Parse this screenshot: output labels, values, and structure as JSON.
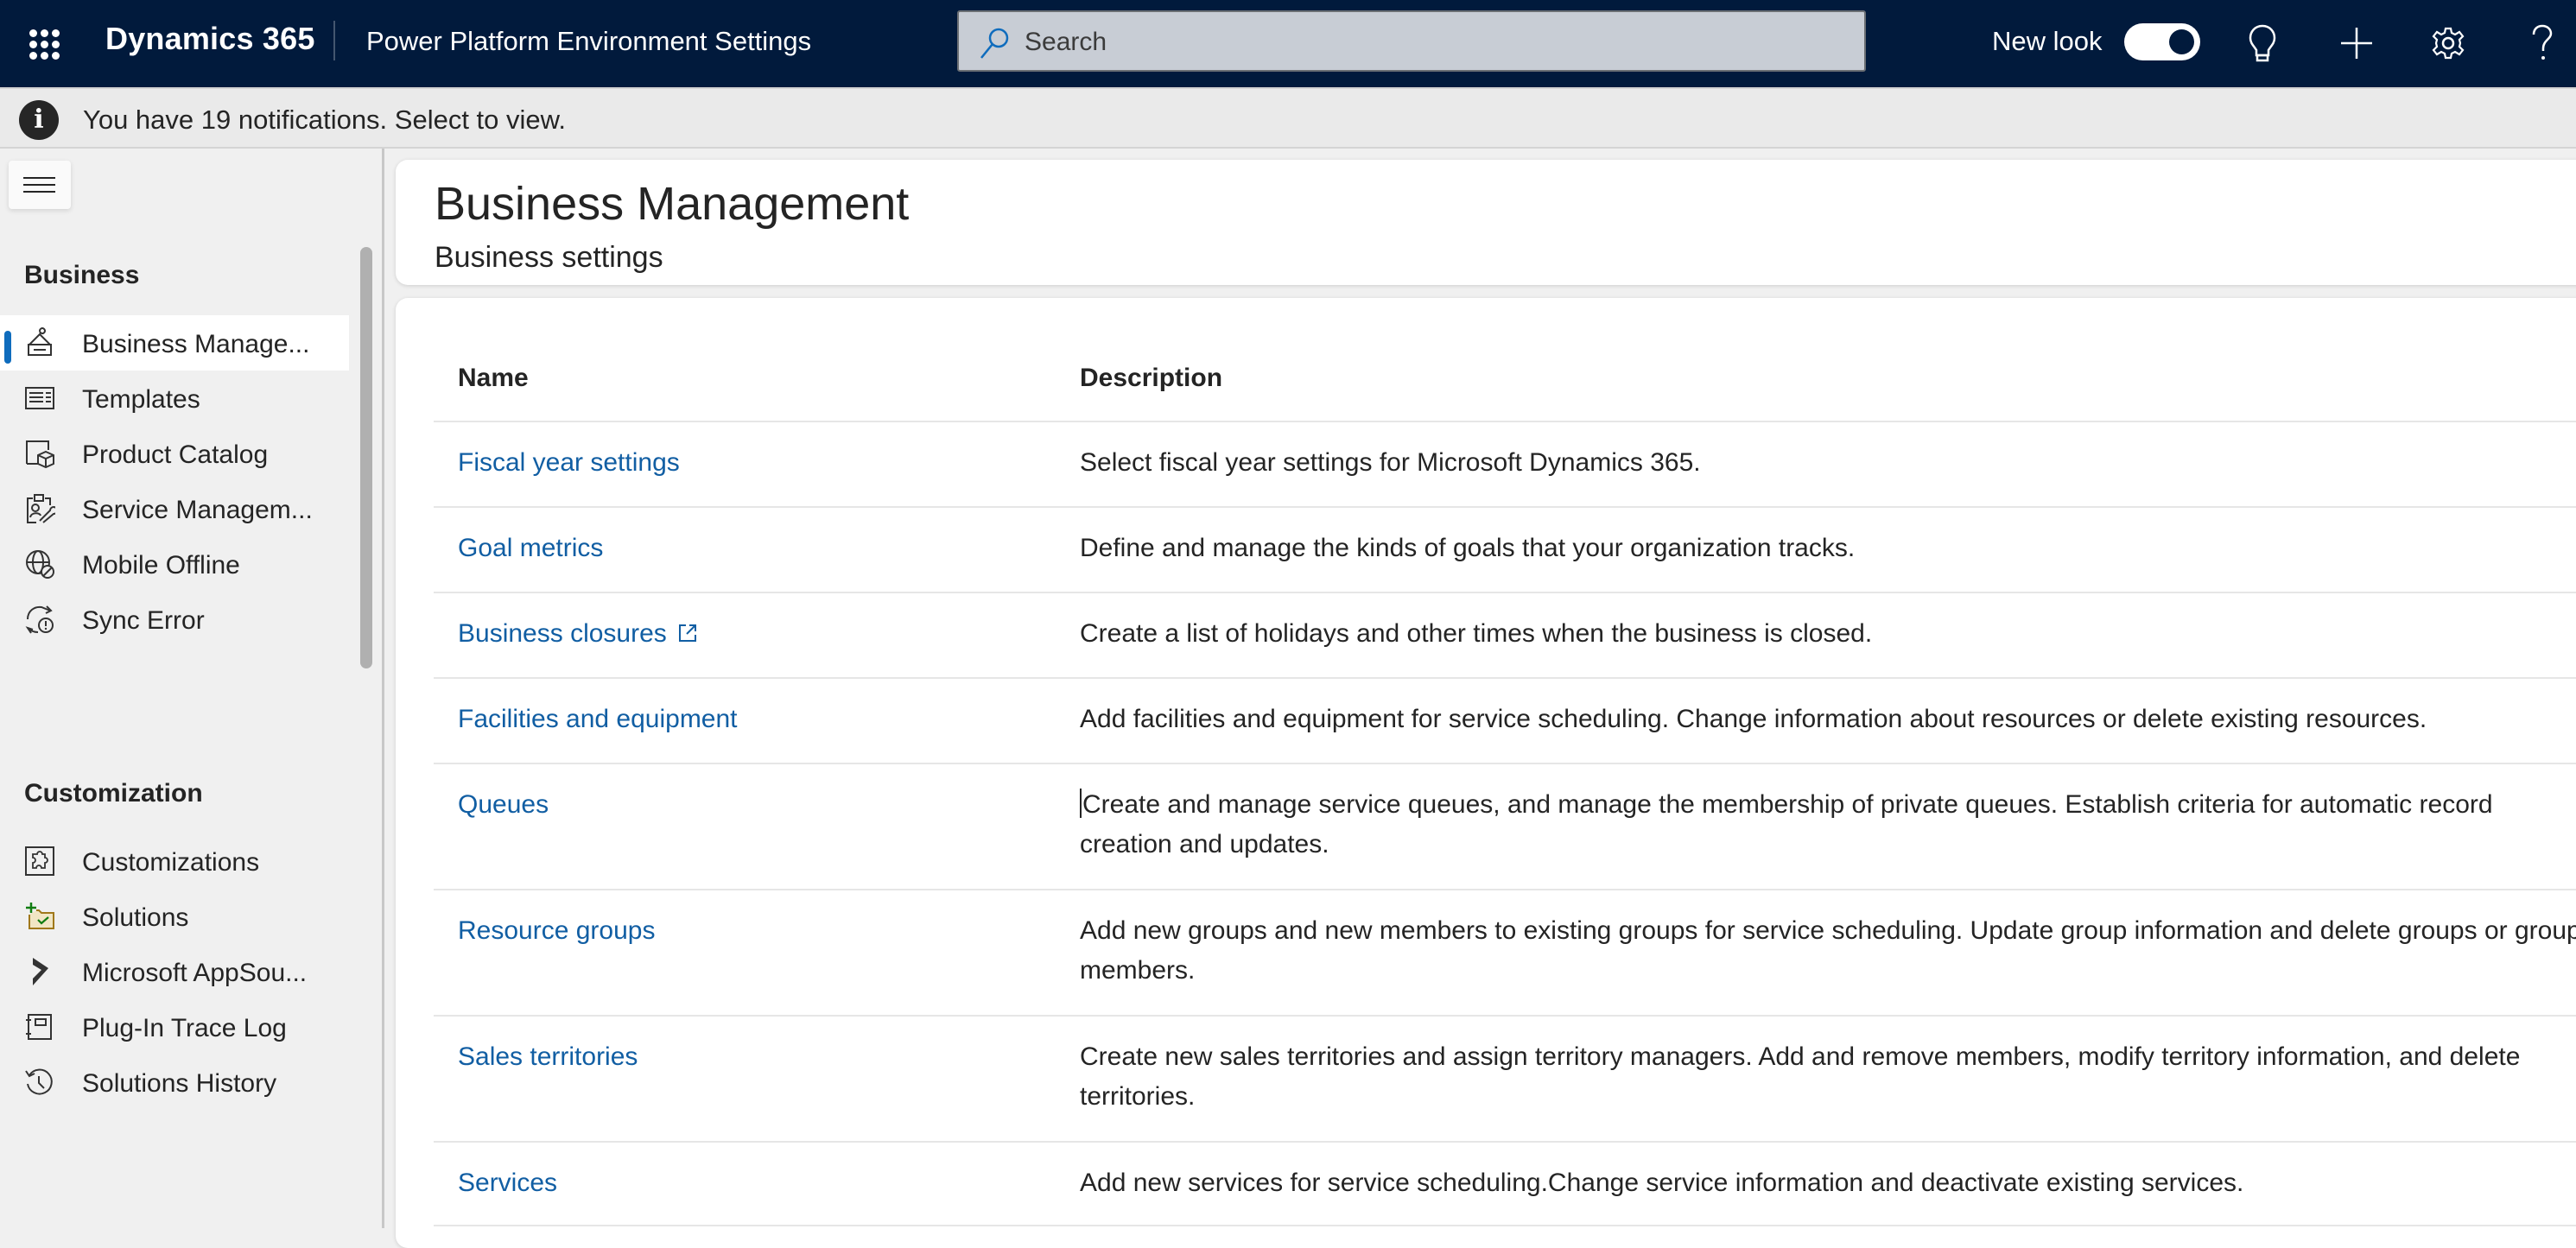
{
  "topbar": {
    "brand": "Dynamics 365",
    "app_title": "Power Platform Environment Settings",
    "search_placeholder": "Search",
    "new_look_label": "New look",
    "new_look_enabled": true,
    "icons": [
      "waffle-icon",
      "search-icon",
      "lightbulb-icon",
      "plus-icon",
      "gear-icon",
      "help-icon"
    ],
    "colors": {
      "background": "#011A3C",
      "text": "#FFFFFF"
    }
  },
  "notification": {
    "message": "You have 19 notifications. Select to view.",
    "count": 19,
    "icon": "info-icon"
  },
  "sidebar": {
    "sections": [
      {
        "title": "Business",
        "items": [
          {
            "label": "Business Manage...",
            "icon": "business-management-icon",
            "active": true
          },
          {
            "label": "Templates",
            "icon": "templates-icon",
            "active": false
          },
          {
            "label": "Product Catalog",
            "icon": "product-catalog-icon",
            "active": false
          },
          {
            "label": "Service Managem...",
            "icon": "service-management-icon",
            "active": false
          },
          {
            "label": "Mobile Offline",
            "icon": "mobile-offline-icon",
            "active": false
          },
          {
            "label": "Sync Error",
            "icon": "sync-error-icon",
            "active": false
          }
        ]
      },
      {
        "title": "Customization",
        "items": [
          {
            "label": "Customizations",
            "icon": "customizations-icon",
            "active": false
          },
          {
            "label": "Solutions",
            "icon": "solutions-icon",
            "active": false
          },
          {
            "label": "Microsoft AppSou...",
            "icon": "appsource-icon",
            "active": false
          },
          {
            "label": "Plug-In Trace Log",
            "icon": "plugin-trace-log-icon",
            "active": false
          },
          {
            "label": "Solutions History",
            "icon": "solutions-history-icon",
            "active": false
          }
        ]
      }
    ],
    "accent_color": "#0F6CBD"
  },
  "main": {
    "title": "Business Management",
    "subtitle": "Business settings",
    "table": {
      "columns": [
        "Name",
        "Description"
      ],
      "rows": [
        {
          "name": "Fiscal year settings",
          "external": false,
          "description": "Select fiscal year settings for Microsoft Dynamics 365."
        },
        {
          "name": "Goal metrics",
          "external": false,
          "description": "Define and manage the kinds of goals that your organization tracks."
        },
        {
          "name": "Business closures",
          "external": true,
          "description": "Create a list of holidays and other times when the business is closed."
        },
        {
          "name": "Facilities and equipment",
          "external": false,
          "description": "Add facilities and equipment for service scheduling. Change information about resources or delete existing resources."
        },
        {
          "name": "Queues",
          "external": false,
          "description": "Create and manage service queues, and manage the membership of private queues. Establish criteria for automatic record creation and updates."
        },
        {
          "name": "Resource groups",
          "external": false,
          "description": "Add new groups and new members to existing groups for service scheduling. Update group information and delete groups or group members."
        },
        {
          "name": "Sales territories",
          "external": false,
          "description": "Create new sales territories and assign territory managers. Add and remove members, modify territory information, and delete territories."
        },
        {
          "name": "Services",
          "external": false,
          "description": "Add new services for service scheduling.Change service information and deactivate existing services."
        }
      ]
    },
    "link_color": "#115EA3"
  }
}
